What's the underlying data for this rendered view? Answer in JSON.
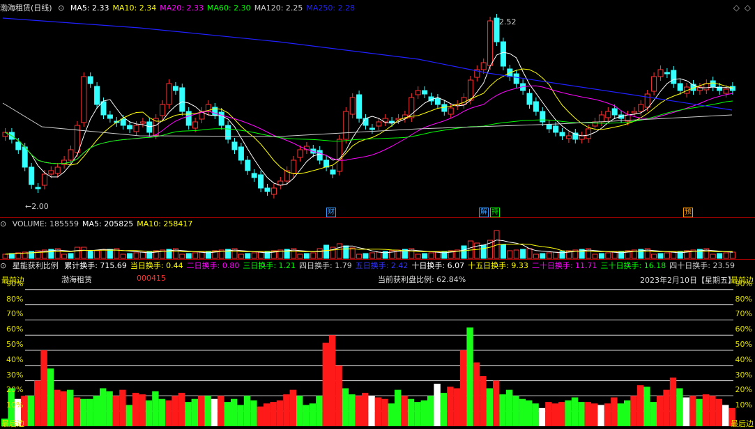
{
  "main": {
    "stock_name": "渤海租赁",
    "period": "(日线)",
    "ma_items": [
      {
        "label": "MA5: 2.33",
        "color": "#ffffff"
      },
      {
        "label": "MA10: 2.34",
        "color": "#ffff00"
      },
      {
        "label": "MA20: 2.33",
        "color": "#ff00ff"
      },
      {
        "label": "MA60: 2.30",
        "color": "#00ff00"
      },
      {
        "label": "MA120: 2.25",
        "color": "#cccccc"
      },
      {
        "label": "MA250: 2.28",
        "color": "#2020ff"
      }
    ],
    "high_label": "2.52",
    "low_label": "2.00",
    "event_tags": [
      {
        "text": "财",
        "color": "#3399ff"
      },
      {
        "text": "解",
        "color": "#3399ff"
      },
      {
        "text": "持",
        "color": "#00ff00"
      },
      {
        "text": "预",
        "color": "#ff9900"
      }
    ]
  },
  "volume": {
    "items": [
      {
        "label": "VOLUME: 185559",
        "color": "#cccccc"
      },
      {
        "label": "MA5: 205825",
        "color": "#ffffff"
      },
      {
        "label": "MA10: 258417",
        "color": "#ffff00"
      }
    ]
  },
  "indicator": {
    "name": "星能获利比例",
    "items": [
      {
        "label": "累计换手: 715.69",
        "color": "#ffffff"
      },
      {
        "label": "当日换手: 0.44",
        "color": "#ffff00"
      },
      {
        "label": "二日换手: 0.80",
        "color": "#ff00ff"
      },
      {
        "label": "三日换手: 1.21",
        "color": "#00ff00"
      },
      {
        "label": "四日换手: 1.79",
        "color": "#cccccc"
      },
      {
        "label": "五日换手: 2.42",
        "color": "#3333ff"
      },
      {
        "label": "十日换手: 6.07",
        "color": "#ffffff"
      },
      {
        "label": "十五日换手: 9.33",
        "color": "#ffff00"
      },
      {
        "label": "二十日换手: 11.71",
        "color": "#ff00ff"
      },
      {
        "label": "三十日换手: 16.18",
        "color": "#00ff00"
      },
      {
        "label": "四十日换手: 23.59",
        "color": "#cccccc"
      }
    ],
    "left_top": "最前边",
    "left_bottom": "最后边",
    "right_top": "最前边",
    "right_bottom": "最后边",
    "panel_name": "渤海租赁",
    "code": "000415",
    "profit_text": "当前获利盘比例: 62.84%",
    "date_text": "2023年2月10日【星期五】",
    "y_labels": [
      "90%",
      "80%",
      "70%",
      "60%",
      "50%",
      "40%",
      "30%",
      "20%",
      "10%"
    ]
  },
  "chart_data": {
    "type": "bar",
    "title": "当前获利盘比例: 62.84%",
    "ylim": [
      0,
      100
    ],
    "y_ticks": [
      10,
      20,
      30,
      40,
      50,
      60,
      70,
      80,
      90
    ],
    "series": [
      {
        "name": "获利比例",
        "values": [
          5,
          25,
          18,
          20,
          20,
          30,
          50,
          38,
          24,
          23,
          24,
          19,
          18,
          18,
          20,
          25,
          23,
          20,
          24,
          14,
          22,
          21,
          17,
          23,
          18,
          17,
          20,
          22,
          16,
          18,
          20,
          20,
          18,
          20,
          16,
          18,
          14,
          20,
          17,
          13,
          15,
          16,
          17,
          21,
          24,
          20,
          14,
          15,
          20,
          55,
          60,
          40,
          25,
          21,
          20,
          22,
          20,
          19,
          18,
          15,
          24,
          20,
          18,
          16,
          17,
          20,
          28,
          22,
          26,
          25,
          50,
          65,
          42,
          33,
          25,
          30,
          21,
          24,
          20,
          18,
          17,
          15,
          12,
          16,
          15,
          16,
          17,
          19,
          16,
          16,
          15,
          14,
          15,
          19,
          15,
          17,
          20,
          27,
          26,
          16,
          20,
          24,
          32,
          25,
          19,
          20,
          18,
          21,
          20,
          18,
          14,
          12
        ]
      },
      {
        "name": "color",
        "values": [
          "g",
          "g",
          "w",
          "r",
          "g",
          "r",
          "r",
          "g",
          "r",
          "r",
          "g",
          "r",
          "g",
          "g",
          "g",
          "g",
          "g",
          "r",
          "r",
          "g",
          "r",
          "r",
          "g",
          "g",
          "g",
          "r",
          "r",
          "r",
          "g",
          "g",
          "r",
          "g",
          "w",
          "r",
          "g",
          "g",
          "g",
          "g",
          "g",
          "r",
          "r",
          "r",
          "r",
          "r",
          "r",
          "g",
          "g",
          "g",
          "g",
          "r",
          "r",
          "r",
          "g",
          "g",
          "r",
          "r",
          "w",
          "r",
          "r",
          "g",
          "g",
          "r",
          "g",
          "g",
          "g",
          "g",
          "w",
          "g",
          "r",
          "r",
          "r",
          "g",
          "r",
          "r",
          "g",
          "r",
          "g",
          "g",
          "g",
          "g",
          "g",
          "g",
          "w",
          "r",
          "r",
          "r",
          "g",
          "g",
          "g",
          "r",
          "r",
          "w",
          "r",
          "r",
          "g",
          "g",
          "r",
          "r",
          "g",
          "g",
          "r",
          "r",
          "r",
          "g",
          "w",
          "r",
          "g",
          "r",
          "r",
          "r",
          "w",
          "r"
        ]
      }
    ]
  }
}
